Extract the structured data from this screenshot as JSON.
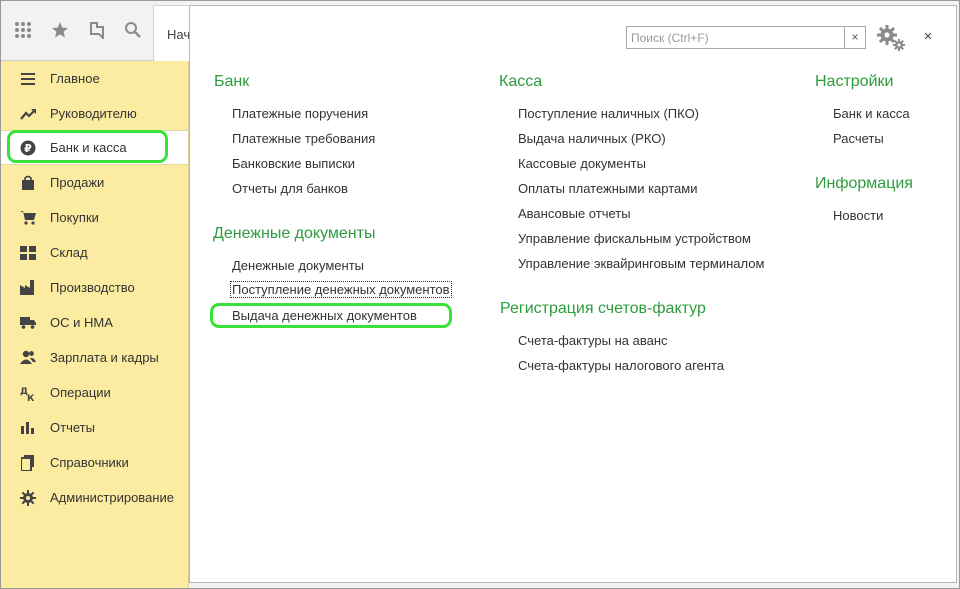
{
  "toolbar": {
    "partial_tab_label": "Нач"
  },
  "sidebar": {
    "items": [
      {
        "label": "Главное",
        "icon": "menu-lines-icon"
      },
      {
        "label": "Руководителю",
        "icon": "trend-up-icon"
      },
      {
        "label": "Банк и касса",
        "icon": "ruble-coin-icon"
      },
      {
        "label": "Продажи",
        "icon": "shopping-bag-icon"
      },
      {
        "label": "Покупки",
        "icon": "cart-icon"
      },
      {
        "label": "Склад",
        "icon": "warehouse-icon"
      },
      {
        "label": "Производство",
        "icon": "factory-icon"
      },
      {
        "label": "ОС и НМА",
        "icon": "truck-icon"
      },
      {
        "label": "Зарплата и кадры",
        "icon": "people-icon"
      },
      {
        "label": "Операции",
        "icon": "debit-credit-icon"
      },
      {
        "label": "Отчеты",
        "icon": "bar-chart-icon"
      },
      {
        "label": "Справочники",
        "icon": "books-icon"
      },
      {
        "label": "Администрирование",
        "icon": "gear-icon"
      }
    ],
    "active_index": 2
  },
  "panel": {
    "search": {
      "placeholder": "Поиск (Ctrl+F)",
      "value": "",
      "clear_label": "×"
    },
    "close_label": "×",
    "sections": {
      "bank": {
        "title": "Банк",
        "links": [
          "Платежные поручения",
          "Платежные требования",
          "Банковские выписки",
          "Отчеты для банков"
        ]
      },
      "money_docs": {
        "title": "Денежные документы",
        "links": [
          "Денежные документы",
          "Поступление денежных документов",
          "Выдача денежных документов"
        ]
      },
      "kassa": {
        "title": "Касса",
        "links": [
          "Поступление наличных (ПКО)",
          "Выдача наличных (РКО)",
          "Кассовые документы",
          "Оплаты платежными картами",
          "Авансовые отчеты",
          "Управление фискальным устройством",
          "Управление эквайринговым терминалом"
        ]
      },
      "invoices": {
        "title": "Регистрация счетов-фактур",
        "links": [
          "Счета-фактуры на аванс",
          "Счета-фактуры налогового агента"
        ]
      },
      "settings": {
        "title": "Настройки",
        "links": [
          "Банк и касса",
          "Расчеты"
        ]
      },
      "info": {
        "title": "Информация",
        "links": [
          "Новости"
        ]
      }
    }
  },
  "colors": {
    "sidebar_bg": "#fbeca2",
    "section_title": "#2c9c3c",
    "highlight": "#38e238"
  }
}
